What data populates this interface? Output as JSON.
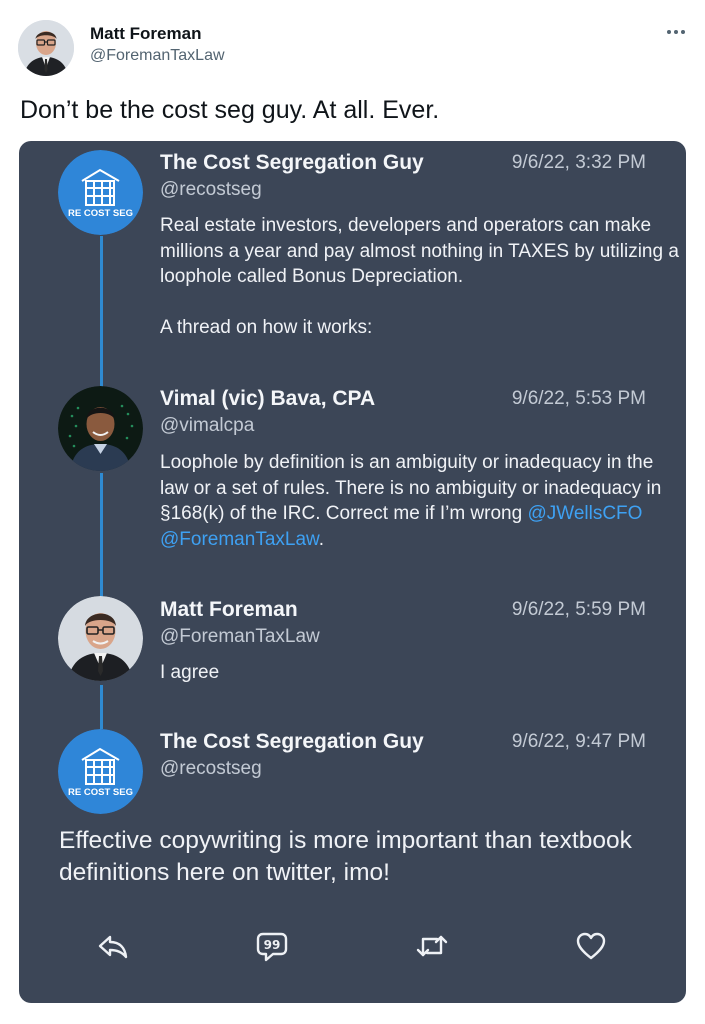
{
  "outer_tweet": {
    "author_name": "Matt Foreman",
    "author_handle": "@ForemanTaxLaw",
    "text": "Don’t be the cost seg guy.  At all.  Ever.",
    "more_icon": "more-dots-icon"
  },
  "screenshot": {
    "tweets": [
      {
        "name": "The Cost Segregation Guy",
        "handle": "@recostseg",
        "time": "9/6/22, 3:32 PM",
        "avatar_label": "RE COST SEG",
        "text": "Real estate investors, developers and operators can make millions a year and pay almost nothing in TAXES by utilizing a loophole called Bonus Depreciation.\n\nA thread on how it works:"
      },
      {
        "name": "Vimal (vic) Bava, CPA",
        "handle": "@vimalcpa",
        "time": "9/6/22, 5:53 PM",
        "text_before_links": "Loophole by definition is an ambiguity or inadequacy in the law or a set of rules. There is no ambiguity or inadequacy in §168(k) of the IRC. Correct me if I’m wrong ",
        "link1": "@JWellsCFO",
        "link2": "@ForemanTaxLaw",
        "text_end": "."
      },
      {
        "name": "Matt Foreman",
        "handle": "@ForemanTaxLaw",
        "time": "9/6/22, 5:59 PM",
        "text": "I agree"
      },
      {
        "name": "The Cost Segregation Guy",
        "handle": "@recostseg",
        "time": "9/6/22, 9:47 PM",
        "avatar_label": "RE COST SEG"
      }
    ],
    "reply_text": "Effective copywriting is more important than textbook definitions here on twitter, imo!",
    "actions": [
      "reply-icon",
      "quote-icon",
      "retweet-icon",
      "like-icon"
    ]
  },
  "colors": {
    "card_background": "#3c4657",
    "thread_line": "#2f8ad1",
    "link": "#3ea1f3",
    "logo_blue": "#2f86d8"
  }
}
